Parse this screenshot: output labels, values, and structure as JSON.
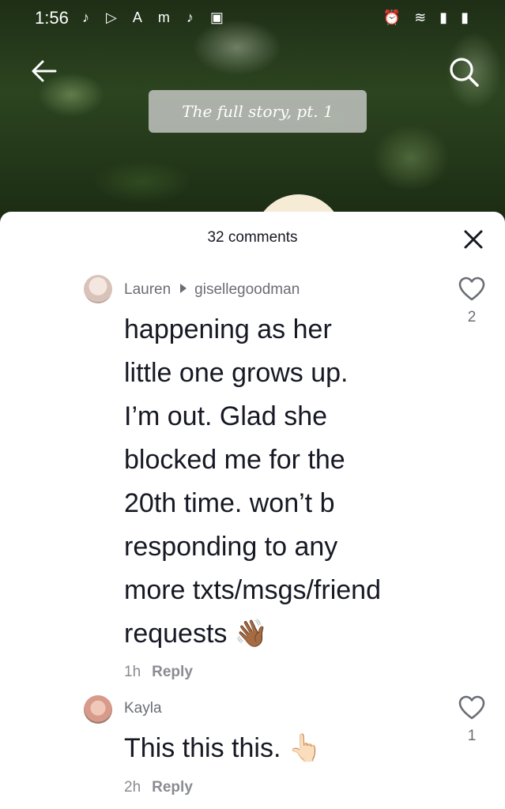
{
  "status_bar": {
    "time": "1:56",
    "left_icons": [
      "tiktok-icon",
      "play-icon",
      "a-icon",
      "m-icon",
      "tiktok-icon",
      "image-icon"
    ],
    "right_icons": [
      "alarm-icon",
      "wifi-icon",
      "signal-icon",
      "battery-icon"
    ]
  },
  "video": {
    "overlay_title": "The full story, pt. 1"
  },
  "sheet": {
    "header": "32 comments",
    "comments": [
      {
        "username": "Lauren",
        "reply_to": "gisellegoodman",
        "lines": [
          "happening as her",
          "little one grows up.",
          "I’m out. Glad she",
          "blocked me for the",
          "20th time. won’t b",
          "responding to any",
          "more txts/msgs/friend",
          "requests"
        ],
        "emoji": "👋🏾",
        "time": "1h",
        "reply_label": "Reply",
        "likes": "2"
      },
      {
        "username": "Kayla",
        "text": "This this this.",
        "emoji": "👆🏻",
        "time": "2h",
        "reply_label": "Reply",
        "likes": "1"
      }
    ]
  }
}
